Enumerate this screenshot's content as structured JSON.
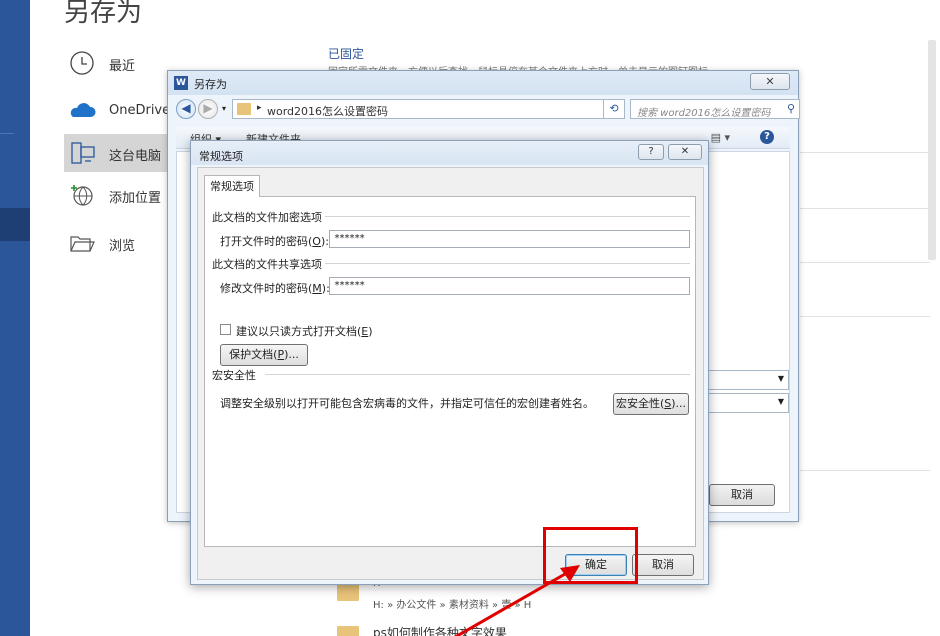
{
  "backstage": {
    "title": "另存为",
    "nav": [
      {
        "label": "最近",
        "icon": "clock-icon"
      },
      {
        "label": "OneDrive",
        "icon": "cloud-icon"
      },
      {
        "label": "这台电脑",
        "icon": "computer-icon"
      },
      {
        "label": "添加位置",
        "icon": "globe-add-icon"
      },
      {
        "label": "浏览",
        "icon": "folder-open-icon"
      }
    ],
    "pinned_title": "已固定",
    "pinned_desc": "固定所需文件夹，方便以后查找。鼠标悬停在某个文件夹上方时，单击显示的图钉图标。",
    "recent_folder_name": "H",
    "recent_folder_path": "H: » 办公文件 » 素材资料 » 壹 » H",
    "recent_folder2": "ps如何制作各种文字效果"
  },
  "save_dialog": {
    "title": "另存为",
    "close_label": "✕",
    "address_path": "word2016怎么设置密码",
    "search_placeholder": "搜索 word2016怎么设置密码",
    "organize_label": "组织 ▾",
    "new_folder_label": "新建文件夹",
    "help_label": "?",
    "cancel_label": "取消"
  },
  "options_dialog": {
    "title": "常规选项",
    "help_btn": "?",
    "close_btn": "✕",
    "tab_label": "常规选项",
    "encrypt_group": "此文档的文件加密选项",
    "open_password_label": "打开文件时的密码(",
    "open_password_key": "O",
    "open_password_value": "******",
    "share_group": "此文档的文件共享选项",
    "modify_password_label": "修改文件时的密码(",
    "modify_password_key": "M",
    "modify_password_value": "******",
    "readonly_label": "建议以只读方式打开文档(",
    "readonly_key": "E",
    "readonly_checked": false,
    "protect_label": "保护文档(",
    "protect_key": "P",
    "macro_group": "宏安全性",
    "macro_desc": "调整安全级别以打开可能包含宏病毒的文件，并指定可信任的宏创建者姓名。",
    "macro_btn_label": "宏安全性(",
    "macro_btn_key": "S",
    "ok_label": "确定",
    "cancel_label": "取消"
  },
  "colors": {
    "accent": "#2b579a",
    "highlight": "#e00000"
  }
}
